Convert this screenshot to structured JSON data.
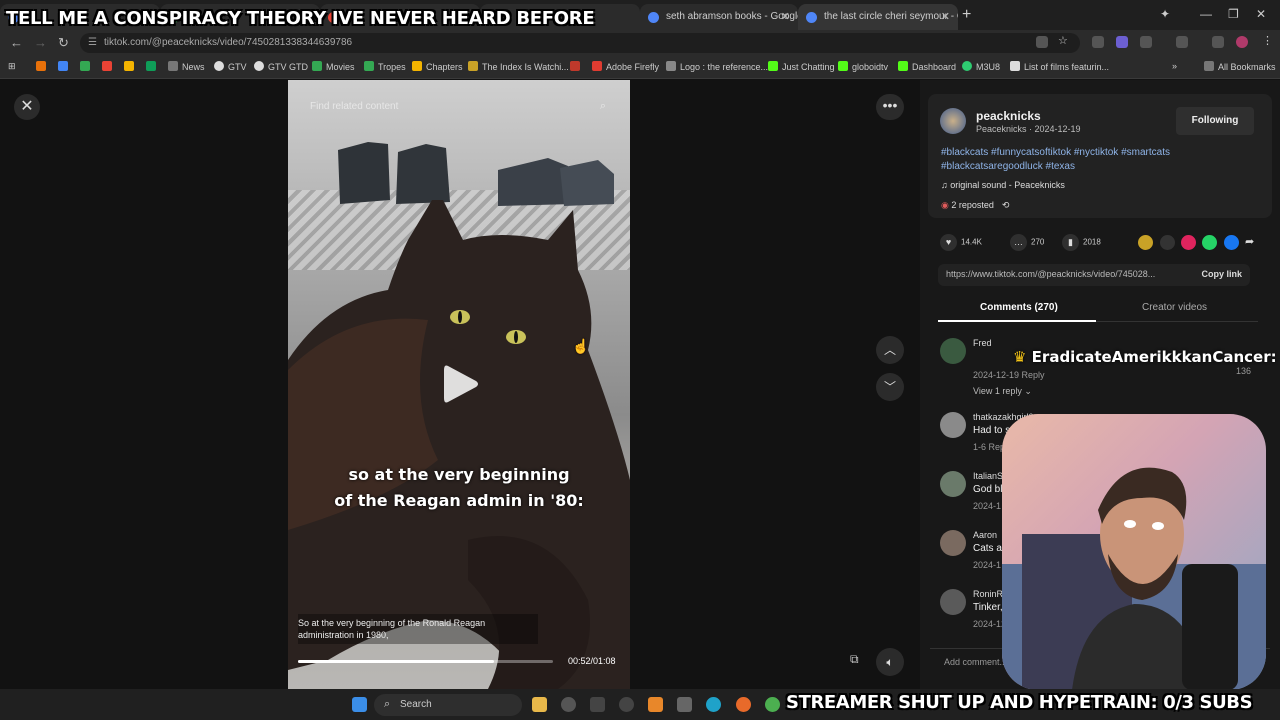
{
  "overlay": {
    "top_text": "TELL ME A CONSPIRACY THEORY IVE NEVER HEARD BEFORE",
    "bottom_text": "STREAMER SHUT UP AND HYPETRAIN: 0/3 SUBS"
  },
  "browser": {
    "tabs": [
      {
        "title": "seth abramson books - Google"
      },
      {
        "title": "the last circle cheri seymour - G"
      }
    ],
    "url": "tiktok.com/@peaceknicks/video/7450281338344639786",
    "bookmarks": [
      {
        "label": "News"
      },
      {
        "label": "GTV"
      },
      {
        "label": "GTV GTD"
      },
      {
        "label": "Movies"
      },
      {
        "label": "Tropes"
      },
      {
        "label": "Chapters"
      },
      {
        "label": "The Index Is Watchi..."
      },
      {
        "label": "Adobe Firefly"
      },
      {
        "label": "Logo : the reference..."
      },
      {
        "label": "Just Chatting"
      },
      {
        "label": "globoidtv"
      },
      {
        "label": "Dashboard"
      },
      {
        "label": "M3U8"
      },
      {
        "label": "List of films featurin..."
      }
    ],
    "all_bookmarks": "All Bookmarks"
  },
  "video": {
    "search_placeholder": "Find related content",
    "subtitle_line1": "so at the very beginning",
    "subtitle_line2": "of the Reagan admin in '80:",
    "caption_line1": "So at the very beginning of the Ronald Reagan",
    "caption_line2": "administration in 1980,",
    "timecode": "00:52/01:08",
    "progress": 0.77
  },
  "author": {
    "username": "peacknicks",
    "nickname_date": "Peaceknicks · 2024-12-19",
    "follow_label": "Following",
    "hashtags": "#blackcats #funnycatsoftiktok #nyctiktok #smartcats #blackcatsaregoodluck #texas",
    "sound": "original sound - Peaceknicks",
    "reposted": "2 reposted"
  },
  "stats": {
    "likes": "14.4K",
    "comments": "270",
    "saves": "2018"
  },
  "link": {
    "url": "https://www.tiktok.com/@peacknicks/video/745028...",
    "copy_label": "Copy link"
  },
  "panel_tabs": {
    "comments": "Comments (270)",
    "creator": "Creator videos"
  },
  "comments": [
    {
      "name": "Fred",
      "text": "",
      "meta": "2024-12-19   Reply"
    },
    {
      "name": "thatkazakhgirl0",
      "text": "Had to subsc",
      "meta": "1-6   Repl"
    },
    {
      "name": "ItalianSt",
      "text": "God bl",
      "meta": "2024-1"
    },
    {
      "name": "Aaron",
      "text": "Cats a",
      "meta": "2024-1"
    },
    {
      "name": "RoninR",
      "text": "Tinker,",
      "meta": "2024-12"
    }
  ],
  "big_comment": "EradicateAmerikkkanCancer:",
  "like_count_fred": "136",
  "view_reply": "View 1 reply",
  "add_comment": "Add comment...",
  "taskbar": {
    "search_label": "Search"
  },
  "colors": {
    "hashtag": "#8fb4e8",
    "page_bg": "#121212"
  }
}
